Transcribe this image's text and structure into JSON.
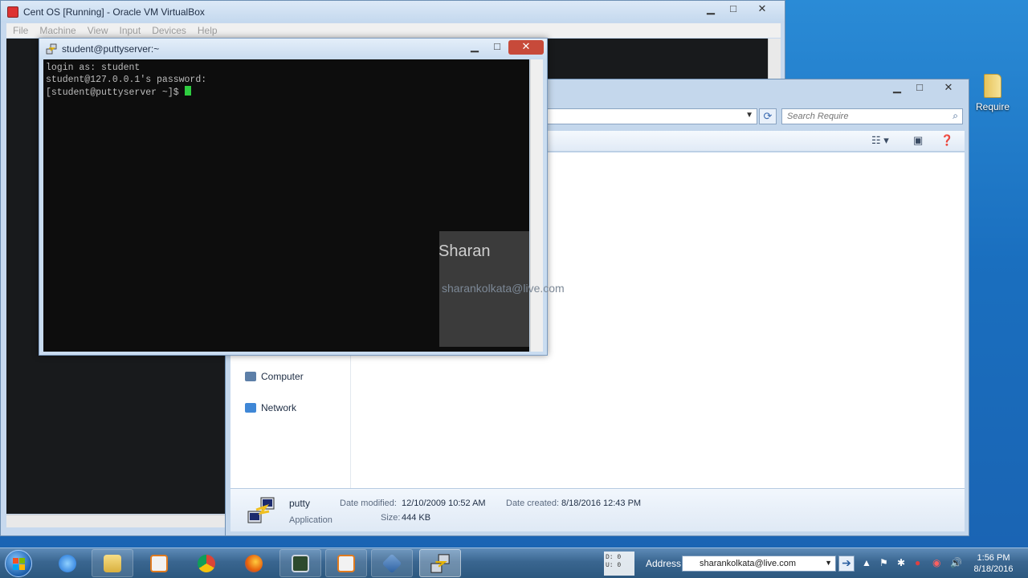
{
  "desktop": {
    "icons": [
      {
        "label": "Require"
      }
    ]
  },
  "vbox": {
    "title": "Cent OS [Running] - Oracle VM VirtualBox",
    "menu": [
      "File",
      "Machine",
      "View",
      "Input",
      "Devices",
      "Help"
    ],
    "buttons": {
      "minimize": "▁",
      "maximize": "□",
      "close": "✕"
    }
  },
  "explorer": {
    "search_placeholder": "Search Require",
    "nav": [
      {
        "label": "Computer"
      },
      {
        "label": "Network"
      }
    ],
    "details": {
      "name": "putty",
      "type": "Application",
      "date_modified_label": "Date modified:",
      "date_modified": "12/10/2009 10:52 AM",
      "date_created_label": "Date created:",
      "date_created": "8/18/2016 12:43 PM",
      "size_label": "Size:",
      "size": "444 KB"
    }
  },
  "putty": {
    "title": "student@puttyserver:~",
    "lines": [
      "login as: student",
      "student@127.0.0.1's password:",
      "[student@puttyserver ~]$ "
    ],
    "cursor_color": "#2ecc40"
  },
  "watermark": {
    "name": "Sharan",
    "email": "sharankolkata@live.com"
  },
  "taskbar": {
    "address_label": "Address",
    "address_value": "sharankolkata@live.com",
    "netmeter": [
      "D: 0",
      "U: 0"
    ],
    "clock_time": "1:56 PM",
    "clock_date": "8/18/2016",
    "apps": [
      "internet-explorer",
      "file-explorer",
      "media-player",
      "chrome",
      "firefox",
      "terminal-app",
      "media-player-2",
      "virtualbox",
      "putty"
    ]
  }
}
